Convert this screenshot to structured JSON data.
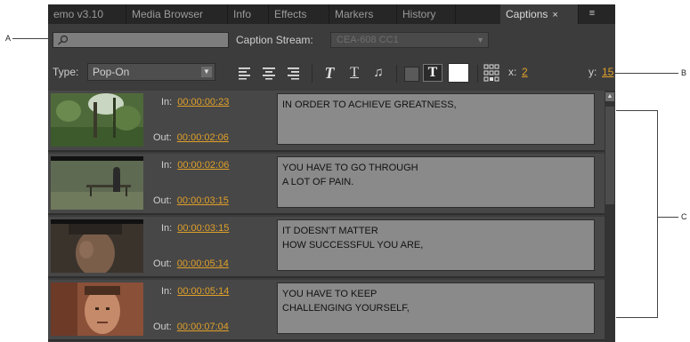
{
  "callouts": {
    "a": "A",
    "b": "B",
    "c": "C"
  },
  "tabs": [
    {
      "label": "emo v3.10"
    },
    {
      "label": "Media Browser"
    },
    {
      "label": "Info"
    },
    {
      "label": "Effects"
    },
    {
      "label": "Markers"
    },
    {
      "label": "History"
    },
    {
      "label": "Captions",
      "close": "×"
    }
  ],
  "panel_menu_icon": "≡",
  "search": {
    "placeholder": ""
  },
  "caption_stream": {
    "label": "Caption Stream:",
    "value": "CEA-608 CC1",
    "arrow": "▼"
  },
  "type": {
    "label": "Type:",
    "value": "Pop-On",
    "arrow": "▼"
  },
  "toolbar": {
    "italic": "T",
    "underline": "T",
    "music": "♫",
    "bold_t": "T",
    "x_label": "x:",
    "x_value": "2",
    "y_label": "y:",
    "y_value": "15"
  },
  "captions": [
    {
      "in_label": "In:",
      "in": "00:00:00:23",
      "out_label": "Out:",
      "out": "00:00:02:06",
      "lines": [
        "IN ORDER TO ACHIEVE GREATNESS,"
      ],
      "thumb": "forest"
    },
    {
      "in_label": "In:",
      "in": "00:00:02:06",
      "out_label": "Out:",
      "out": "00:00:03:15",
      "lines": [
        "YOU HAVE TO GO THROUGH",
        "A LOT OF PAIN."
      ],
      "thumb": "bench"
    },
    {
      "in_label": "In:",
      "in": "00:00:03:15",
      "out_label": "Out:",
      "out": "00:00:05:14",
      "lines": [
        "IT DOESN'T MATTER",
        "HOW SUCCESSFUL YOU ARE,"
      ],
      "thumb": "face-dark"
    },
    {
      "in_label": "In:",
      "in": "00:00:05:14",
      "out_label": "Out:",
      "out": "00:00:07:04",
      "lines": [
        "YOU HAVE TO KEEP",
        "CHALLENGING YOURSELF,"
      ],
      "thumb": "face-warm"
    }
  ],
  "colors": {
    "timecode": "#e0a02a",
    "panel_bg": "#3c3c3c",
    "caption_box": "#8a8a8a"
  }
}
